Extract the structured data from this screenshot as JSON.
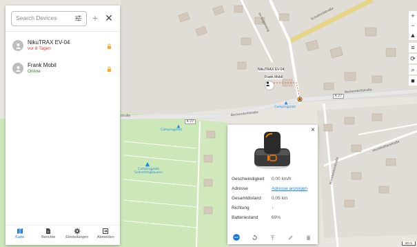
{
  "search": {
    "placeholder": "Search Devices"
  },
  "header": {
    "add_icon": "plus-icon",
    "close_icon": "close-icon",
    "filter_icon": "tune-icon"
  },
  "devices": [
    {
      "name": "NikuTRAX EV-04",
      "status": "vor 8 Tagen",
      "status_color": "#e53935"
    },
    {
      "name": "Frank Mobil",
      "status": "Online",
      "status_color": "#2e7d32"
    }
  ],
  "nav": [
    {
      "label": "Karte",
      "icon": "map-icon",
      "active": true
    },
    {
      "label": "Berichte",
      "icon": "report-icon",
      "active": false
    },
    {
      "label": "Einstellungen",
      "icon": "gear-icon",
      "active": false
    },
    {
      "label": "Abmelden",
      "icon": "logout-icon",
      "active": false
    }
  ],
  "map": {
    "labels": {
      "street_a": "Beckendorfstraße",
      "street_b": "Beckendorfstraße",
      "street_c": "Beckendorfstraße",
      "street_diag": "Schottmöstraße",
      "street_im": "Im Vogelsang",
      "street_horst": "Horstkottenstraße",
      "street_right": "Horstkottenstraße",
      "road_k27a": "K 27",
      "road_k27b": "K 27",
      "camp1": "Campingplatz",
      "camp2": "Campingplatz",
      "camp3": "Campingplatz Schnettinghausen",
      "street_left": "straße"
    },
    "markers": {
      "m1": "NikuTRAX EV-04",
      "m2": "Frank Mobil"
    },
    "scale": "50 m",
    "controls": [
      "+",
      "−",
      "▲",
      "≡",
      "⟳",
      "⌕",
      "■"
    ]
  },
  "popup": {
    "rows": [
      {
        "key": "Geschwindigkeit",
        "value": "0.00 km/h"
      },
      {
        "key": "Adresse",
        "value": "Adresse anzeigen"
      },
      {
        "key": "Gesamtdistanz",
        "value": "0.05 km"
      },
      {
        "key": "Richtung",
        "value": "↑"
      },
      {
        "key": "Batteriestand",
        "value": "69%"
      }
    ],
    "close": "×"
  },
  "colors": {
    "accent": "#1976d2",
    "panel": "#ffffff",
    "lock": "#f9a825"
  }
}
